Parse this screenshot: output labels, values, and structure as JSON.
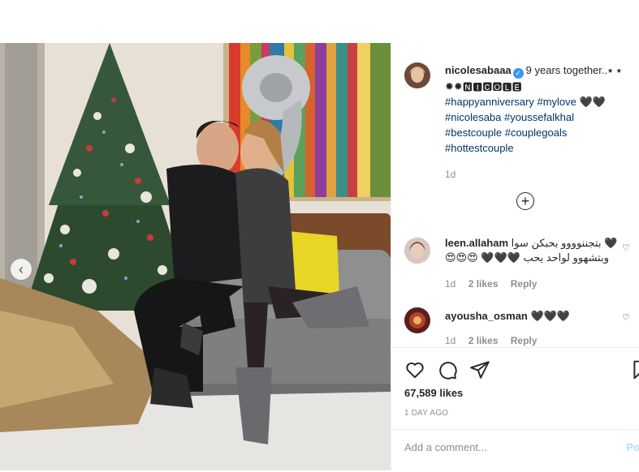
{
  "post": {
    "author": "nicolesabaaa",
    "caption_text": "9 years together..⭑ ⭑ ✹✹🅽🅸🅲🅾🅻🅴",
    "hashtags_line1": "#happyanniversary #mylove 🖤🖤",
    "hashtags_line2": "#nicolesaba #youssefalkhal",
    "hashtags_line3": "#bestcouple #couplegoals",
    "hashtags_line4": "#hottestcouple",
    "time": "1d"
  },
  "comments": [
    {
      "user": "leen.allaham",
      "text_line1": "🖤 بتجننوووو بحبكن سوا",
      "text_line2": "وبتشهوو لواحد يحب 🖤🖤🖤 😍😍😍",
      "time": "1d",
      "likes": "2 likes",
      "reply": "Reply"
    },
    {
      "user": "ayousha_osman",
      "text_line1": "🖤🖤🖤",
      "time": "1d",
      "likes": "2 likes",
      "reply": "Reply"
    }
  ],
  "footer": {
    "likes_count": "67,589 likes",
    "date": "1 DAY AGO",
    "comment_placeholder": "Add a comment...",
    "post_label": "Po"
  },
  "icons": {
    "carousel_prev": "chevron-left-icon",
    "verified": "verified-badge-icon",
    "load_more": "plus-circle-icon",
    "like": "heart-icon",
    "comment": "comment-icon",
    "share": "paper-plane-icon",
    "save": "bookmark-icon"
  },
  "colors": {
    "accent": "#3897f0",
    "hashtag": "#003569",
    "muted": "#8e8e8e",
    "post_button": "#b3dbff"
  }
}
